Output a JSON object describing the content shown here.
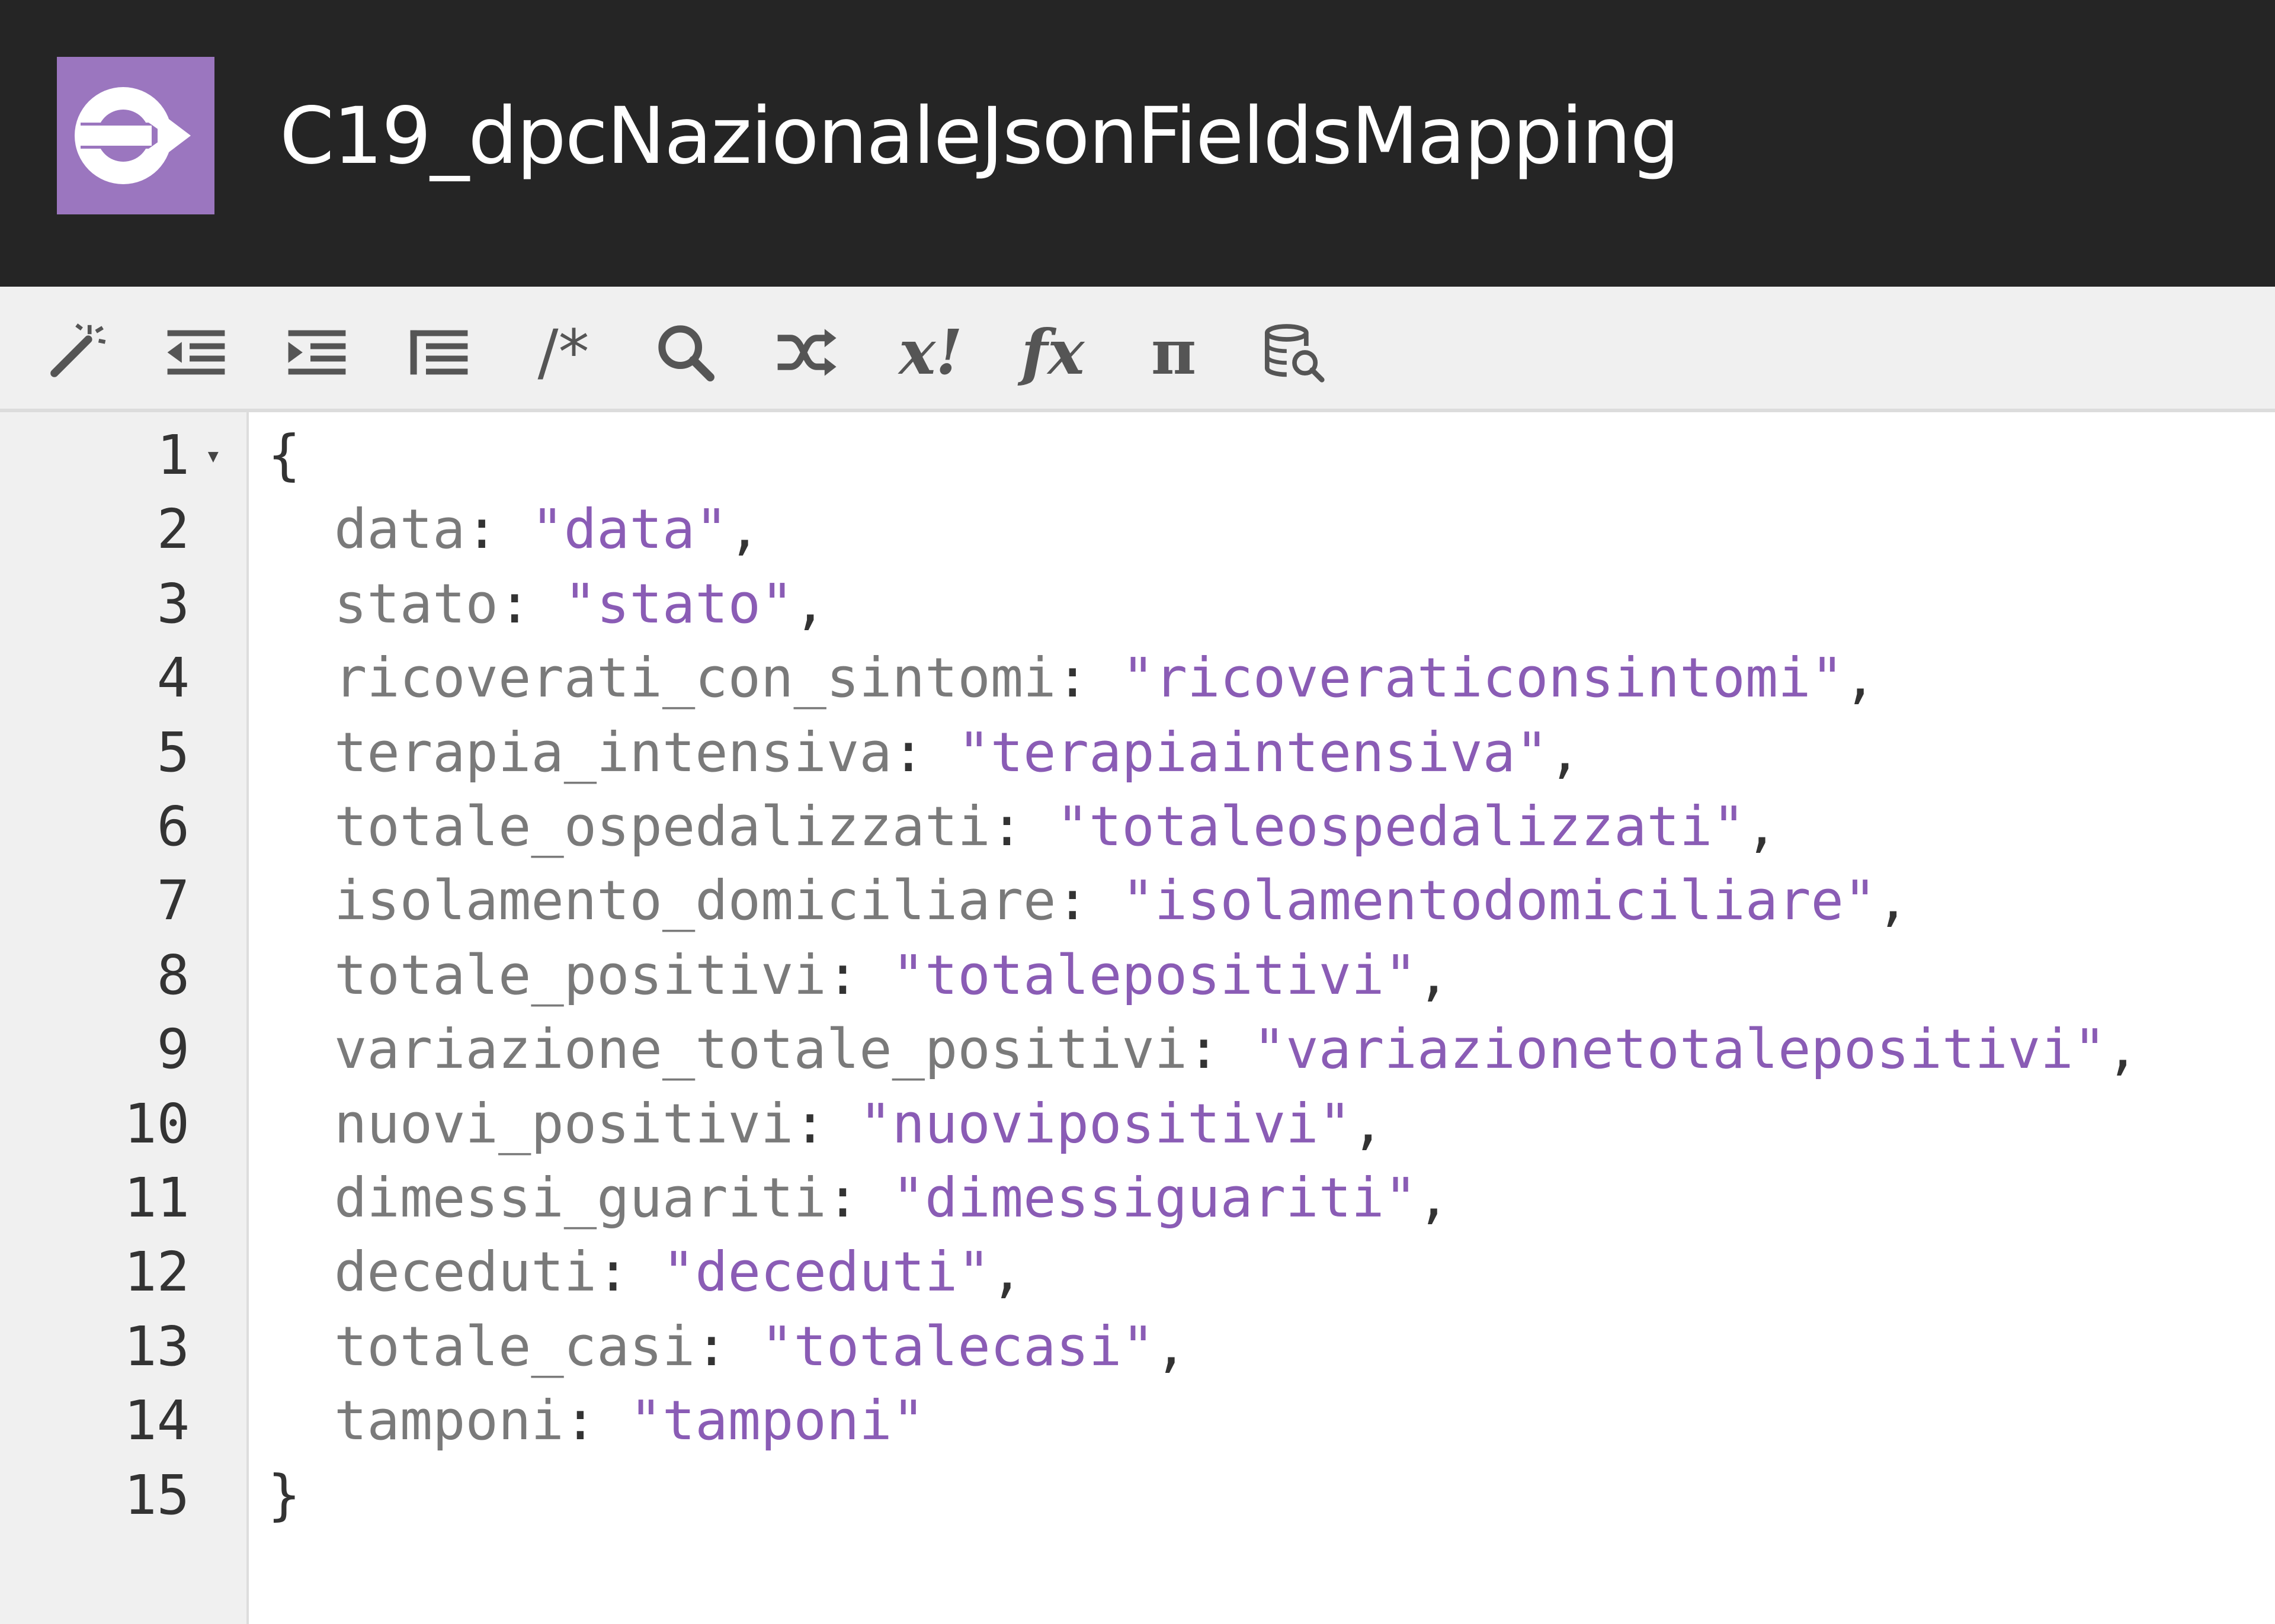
{
  "header": {
    "title": "C19_dpcNazionaleJsonFieldsMapping",
    "icon": "pipe-arrow-icon",
    "accent_color": "#9b76bf",
    "background": "#252525"
  },
  "toolbar": {
    "buttons": [
      {
        "name": "beautify-wand-icon",
        "text": ""
      },
      {
        "name": "outdent-icon",
        "text": ""
      },
      {
        "name": "indent-icon",
        "text": ""
      },
      {
        "name": "list-icon",
        "text": ""
      },
      {
        "name": "comment-icon",
        "text": "/*"
      },
      {
        "name": "search-icon",
        "text": ""
      },
      {
        "name": "shuffle-icon",
        "text": ""
      },
      {
        "name": "x-bang-icon",
        "text": "x!"
      },
      {
        "name": "fx-icon",
        "text": "fx"
      },
      {
        "name": "pi-icon",
        "text": "π"
      },
      {
        "name": "database-search-icon",
        "text": ""
      }
    ]
  },
  "editor": {
    "open_brace": "{",
    "close_brace": "}",
    "lines": [
      {
        "n": "1"
      },
      {
        "n": "2",
        "key": "data",
        "value": "\"data\"",
        "comma": ","
      },
      {
        "n": "3",
        "key": "stato",
        "value": "\"stato\"",
        "comma": ","
      },
      {
        "n": "4",
        "key": "ricoverati_con_sintomi",
        "value": "\"ricoverati​consintomi\"",
        "comma": ","
      },
      {
        "n": "5",
        "key": "terapia_intensiva",
        "value": "\"terapiaintensiva\"",
        "comma": ","
      },
      {
        "n": "6",
        "key": "totale_ospedalizzati",
        "value": "\"totaleospedalizzati\"",
        "comma": ","
      },
      {
        "n": "7",
        "key": "isolamento_domiciliare",
        "value": "\"isolamentodomiciliare\"",
        "comma": ","
      },
      {
        "n": "8",
        "key": "totale_positivi",
        "value": "\"totalepositivi\"",
        "comma": ","
      },
      {
        "n": "9",
        "key": "variazione_totale_positivi",
        "value": "\"variazionetotalepositivi\"",
        "comma": ","
      },
      {
        "n": "10",
        "key": "nuovi_positivi",
        "value": "\"nuovipositivi\"",
        "comma": ","
      },
      {
        "n": "11",
        "key": "dimessi_guariti",
        "value": "\"dimessiguariti\"",
        "comma": ","
      },
      {
        "n": "12",
        "key": "deceduti",
        "value": "\"deceduti\"",
        "comma": ","
      },
      {
        "n": "13",
        "key": "totale_casi",
        "value": "\"totalecasi\"",
        "comma": ","
      },
      {
        "n": "14",
        "key": "tamponi",
        "value": "\"tamponi\"",
        "comma": ""
      },
      {
        "n": "15"
      }
    ],
    "fold_marker": "▾",
    "colors": {
      "key": "#7a7a7a",
      "string": "#8a5cb5",
      "gutter_bg": "#f0f0f0"
    }
  }
}
